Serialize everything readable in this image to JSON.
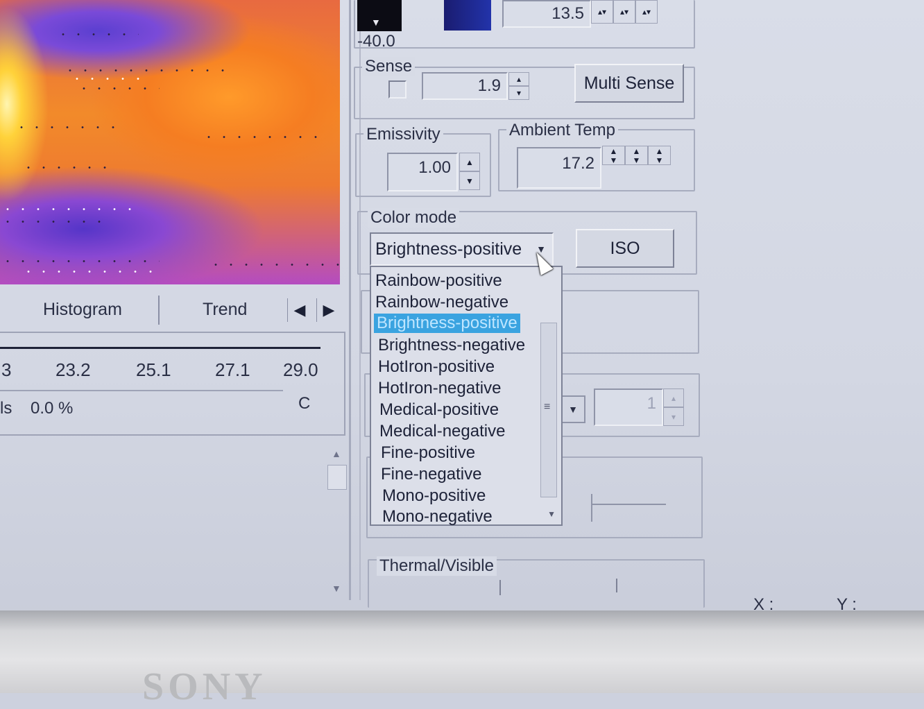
{
  "range": {
    "min_label": "-40.0",
    "max_value": "13.5"
  },
  "sense": {
    "title": "Sense",
    "value": "1.9",
    "multi_sense_label": "Multi Sense"
  },
  "emissivity": {
    "title": "Emissivity",
    "value": "1.00"
  },
  "ambient_temp": {
    "title": "Ambient Temp",
    "value": "17.2"
  },
  "color_mode": {
    "title": "Color mode",
    "selected": "Brightness-positive",
    "iso_label": "ISO",
    "options": [
      "Rainbow-positive",
      "Rainbow-negative",
      "Brightness-positive",
      "Brightness-negative",
      "HotIron-positive",
      "HotIron-negative",
      "Medical-positive",
      "Medical-negative",
      "Fine-positive",
      "Fine-negative",
      "Mono-positive",
      "Mono-negative"
    ],
    "highlighted_index": 2
  },
  "other_spin": {
    "value": "1"
  },
  "thermal_visible": {
    "title": "Thermal/Visible"
  },
  "tabs": {
    "histogram": "Histogram",
    "trend": "Trend"
  },
  "histogram": {
    "ticks": [
      "3",
      "23.2",
      "25.1",
      "27.1",
      "29.0"
    ],
    "unit": "C",
    "stat_label": "ls",
    "stat_value": "0.0 %"
  },
  "coords": {
    "x_label": "X :",
    "y_label": "Y :"
  },
  "bezel": {
    "brand": "SONY"
  },
  "colors": {
    "selection": "#3aa3e0",
    "panel": "#d7dbe6",
    "thermal_hot": "#ffd23a",
    "thermal_mid": "#f28a2a",
    "thermal_cold": "#5b3fd0"
  }
}
